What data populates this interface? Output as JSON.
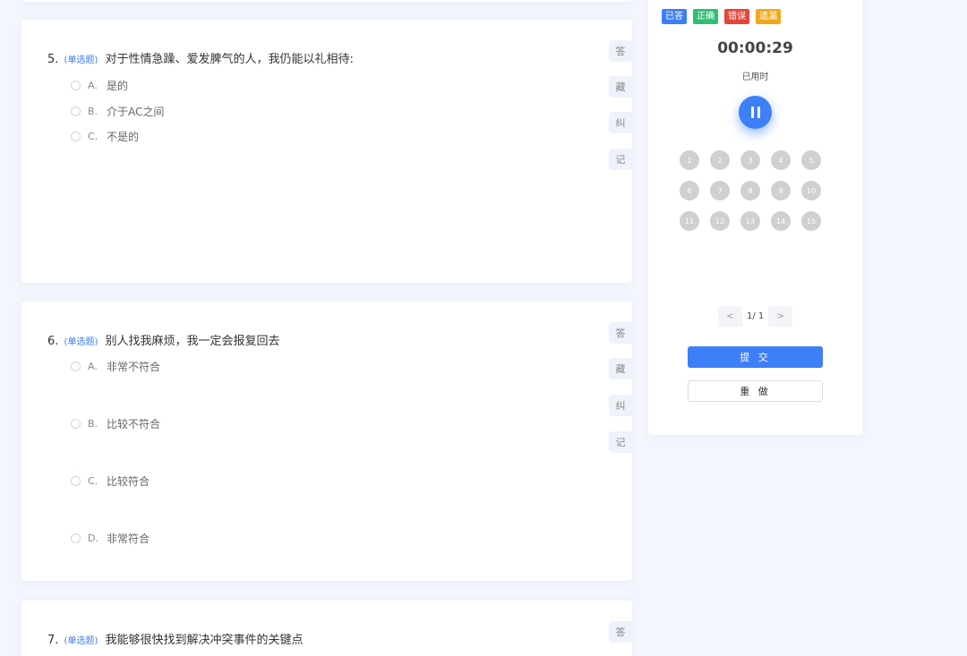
{
  "legend": [
    {
      "label": "已答",
      "color": "#3d7ff7"
    },
    {
      "label": "正确",
      "color": "#2fbf71"
    },
    {
      "label": "错误",
      "color": "#e5463a"
    },
    {
      "label": "遗漏",
      "color": "#f0a81a"
    }
  ],
  "timer": {
    "value": "00:00:29",
    "label": "已用时"
  },
  "pause_icon": "pause-icon",
  "grid": [
    "1",
    "2",
    "3",
    "4",
    "5",
    "6",
    "7",
    "8",
    "9",
    "10",
    "11",
    "12",
    "13",
    "14",
    "15"
  ],
  "pager": {
    "prev": "<",
    "text": "1/ 1",
    "next": ">"
  },
  "actions": {
    "submit": "提 交",
    "redo": "重 做"
  },
  "side_actions": [
    "答",
    "藏",
    "纠",
    "记"
  ],
  "questions": [
    {
      "number": "5.",
      "type": "(单选题)",
      "text": "对于性情急躁、爱发脾气的人，我仍能以礼相待:",
      "options": [
        {
          "key": "A.",
          "label": "是的"
        },
        {
          "key": "B.",
          "label": "介于AC之间"
        },
        {
          "key": "C.",
          "label": "不是的"
        }
      ]
    },
    {
      "number": "6.",
      "type": "(单选题)",
      "text": "别人找我麻烦，我一定会报复回去",
      "options": [
        {
          "key": "A.",
          "label": "非常不符合"
        },
        {
          "key": "B.",
          "label": "比较不符合"
        },
        {
          "key": "C.",
          "label": "比较符合"
        },
        {
          "key": "D.",
          "label": "非常符合"
        }
      ]
    },
    {
      "number": "7.",
      "type": "(单选题)",
      "text": "我能够很快找到解决冲突事件的关键点",
      "options": []
    }
  ]
}
